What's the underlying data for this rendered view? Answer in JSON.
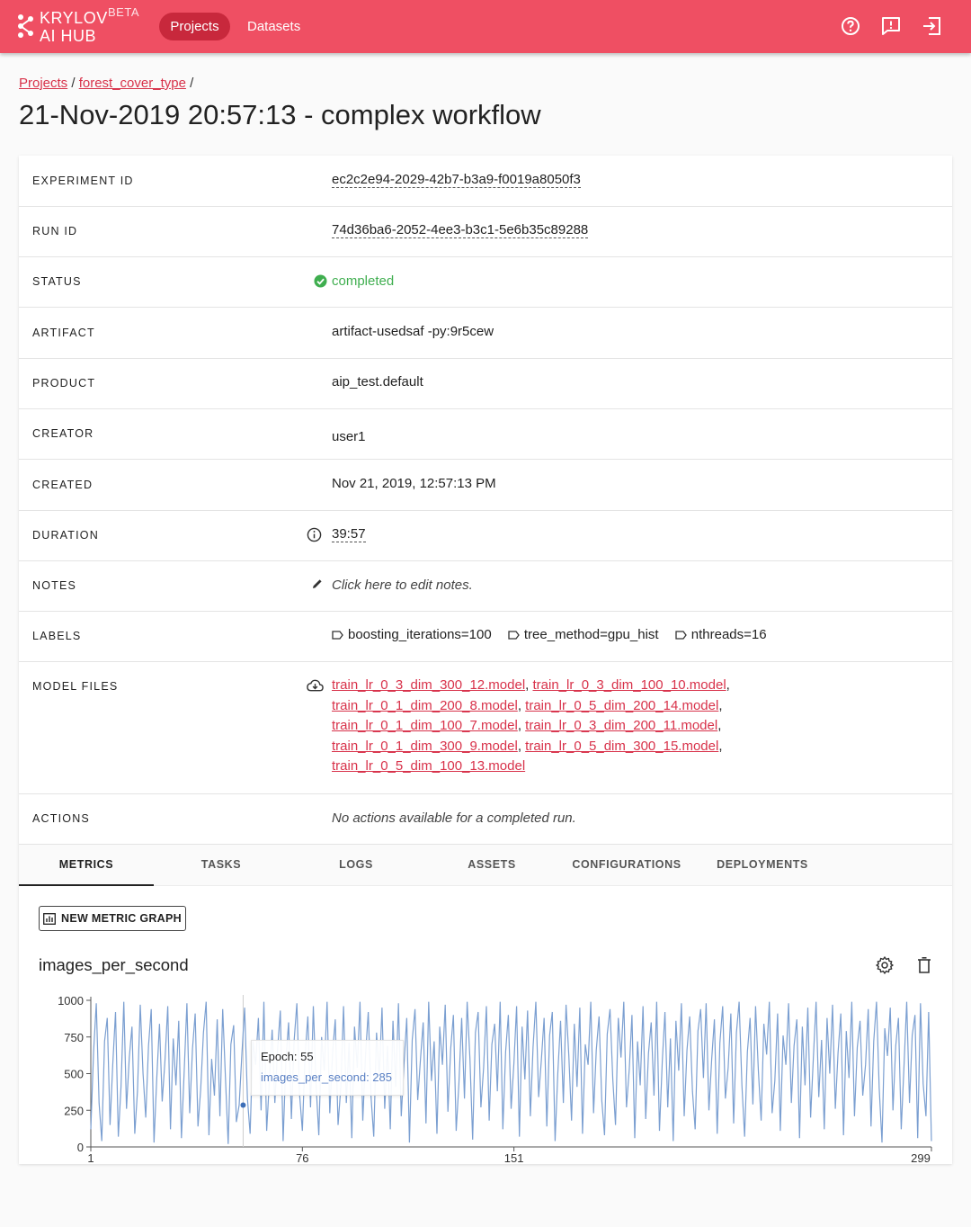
{
  "header": {
    "logo_line1": "KRYLOV",
    "logo_line2": "AI HUB",
    "logo_beta": "BETA",
    "nav": [
      "Projects",
      "Datasets"
    ],
    "icons": [
      "help-icon",
      "feedback-icon",
      "logout-icon"
    ],
    "bar_color": "#ef4f63"
  },
  "breadcrumb": {
    "items": [
      "Projects",
      "forest_cover_type"
    ],
    "separator": "/"
  },
  "page_title": "21-Nov-2019 20:57:13 - complex workflow",
  "details": {
    "experiment_id": {
      "label": "EXPERIMENT ID",
      "value": "ec2c2e94-2029-42b7-b3a9-f0019a8050f3"
    },
    "run_id": {
      "label": "RUN ID",
      "value": "74d36ba6-2052-4ee3-b3c1-5e6b35c89288"
    },
    "status": {
      "label": "STATUS",
      "value": "completed",
      "color": "#3fae4f"
    },
    "artifact": {
      "label": "ARTIFACT",
      "value": "artifact-usedsaf -py:9r5cew"
    },
    "product": {
      "label": "PRODUCT",
      "value": "aip_test.default"
    },
    "creator": {
      "label": "CREATOR",
      "value": "user1"
    },
    "created": {
      "label": "CREATED",
      "value": "Nov 21, 2019, 12:57:13 PM"
    },
    "duration": {
      "label": "DURATION",
      "value": "39:57"
    },
    "notes": {
      "label": "NOTES",
      "value": "Click here to edit notes."
    },
    "labels": {
      "label": "LABELS",
      "values": [
        "boosting_iterations=100",
        "tree_method=gpu_hist",
        "nthreads=16"
      ]
    },
    "model_files": {
      "label": "MODEL FILES",
      "files": [
        "train_lr_0_3_dim_300_12.model",
        "train_lr_0_3_dim_100_10.model",
        "train_lr_0_1_dim_200_8.model",
        "train_lr_0_5_dim_200_14.model",
        "train_lr_0_1_dim_100_7.model",
        "train_lr_0_3_dim_200_11.model",
        "train_lr_0_1_dim_300_9.model",
        "train_lr_0_5_dim_300_15.model",
        "train_lr_0_5_dim_100_13.model"
      ]
    },
    "actions": {
      "label": "ACTIONS",
      "value": "No actions available for a completed run."
    }
  },
  "tabs": [
    "METRICS",
    "TASKS",
    "LOGS",
    "ASSETS",
    "CONFIGURATIONS",
    "DEPLOYMENTS"
  ],
  "active_tab": "METRICS",
  "metrics": {
    "new_graph_label": "NEW METRIC GRAPH",
    "graph_title": "images_per_second",
    "tooltip": {
      "epoch_label": "Epoch: 55",
      "value_label": "images_per_second: 285"
    }
  },
  "chart_data": {
    "type": "line",
    "line_color": "#7b9fd1",
    "yticks": [
      0,
      250,
      500,
      750,
      1000
    ],
    "xticks": [
      1,
      76,
      151,
      299
    ],
    "xlim": [
      1,
      299
    ],
    "ylim": [
      0,
      1000
    ],
    "series": [
      {
        "x_start": 1,
        "x_end": 299,
        "values": [
          120,
          650,
          980,
          300,
          40,
          720,
          880,
          150,
          560,
          920,
          70,
          410,
          990,
          260,
          610,
          820,
          90,
          380,
          970,
          500,
          200,
          690,
          940,
          30,
          460,
          840,
          310,
          590,
          960,
          120,
          740,
          420,
          860,
          60,
          520,
          980,
          230,
          670,
          910,
          140,
          390,
          780,
          990,
          80,
          600,
          350,
          870,
          210,
          940,
          480,
          20,
          700,
          830,
          170,
          285,
          640,
          950,
          330,
          90,
          720,
          560,
          880,
          250,
          990,
          110,
          450,
          800,
          300,
          670,
          930,
          40,
          580,
          850,
          190,
          720,
          980,
          360,
          110,
          620,
          890,
          270,
          960,
          420,
          80,
          750,
          520,
          990,
          230,
          640,
          870,
          150,
          410,
          960,
          300,
          710,
          60,
          820,
          540,
          990,
          180,
          630,
          920,
          340,
          70,
          780,
          480,
          950,
          260,
          690,
          120,
          860,
          410,
          980,
          210,
          560,
          880,
          30,
          730,
          940,
          320,
          600,
          850,
          160,
          990,
          450,
          720,
          90,
          820,
          560,
          970,
          240,
          670,
          900,
          110,
          430,
          880,
          330,
          990,
          600,
          50,
          780,
          920,
          270,
          540,
          960,
          180,
          700,
          840,
          380,
          990,
          120,
          650,
          900,
          260,
          570,
          960,
          70,
          820,
          460,
          930,
          210,
          680,
          990,
          340,
          590,
          880,
          140,
          760,
          920,
          40,
          500,
          860,
          300,
          970,
          620,
          180,
          840,
          410,
          950,
          90,
          700,
          560,
          990,
          230,
          660,
          890,
          320,
          80,
          770,
          940,
          460,
          150,
          880,
          610,
          990,
          270,
          530,
          900,
          60,
          720,
          420,
          960,
          190,
          640,
          850,
          350,
          990,
          110,
          580,
          920,
          270,
          740,
          40,
          860,
          520,
          980,
          210,
          660,
          890,
          380,
          120,
          790,
          940,
          470,
          980,
          250,
          600,
          870,
          90,
          710,
          960,
          330,
          540,
          910,
          160,
          780,
          990,
          420,
          70,
          650,
          880,
          290,
          960,
          520,
          180,
          840,
          630,
          990,
          230,
          450,
          910,
          110,
          760,
          560,
          980,
          300,
          690,
          870,
          60,
          820,
          420,
          950,
          200,
          600,
          990,
          340,
          730,
          120,
          880,
          500,
          970,
          260,
          640,
          910,
          80,
          790,
          470,
          990,
          210,
          680,
          860,
          350,
          560,
          940,
          140,
          720,
          990,
          400,
          30,
          810,
          620,
          950,
          250,
          690,
          880,
          120,
          540,
          990,
          300,
          760,
          900,
          60,
          980,
          430,
          210,
          920,
          40
        ]
      }
    ]
  }
}
